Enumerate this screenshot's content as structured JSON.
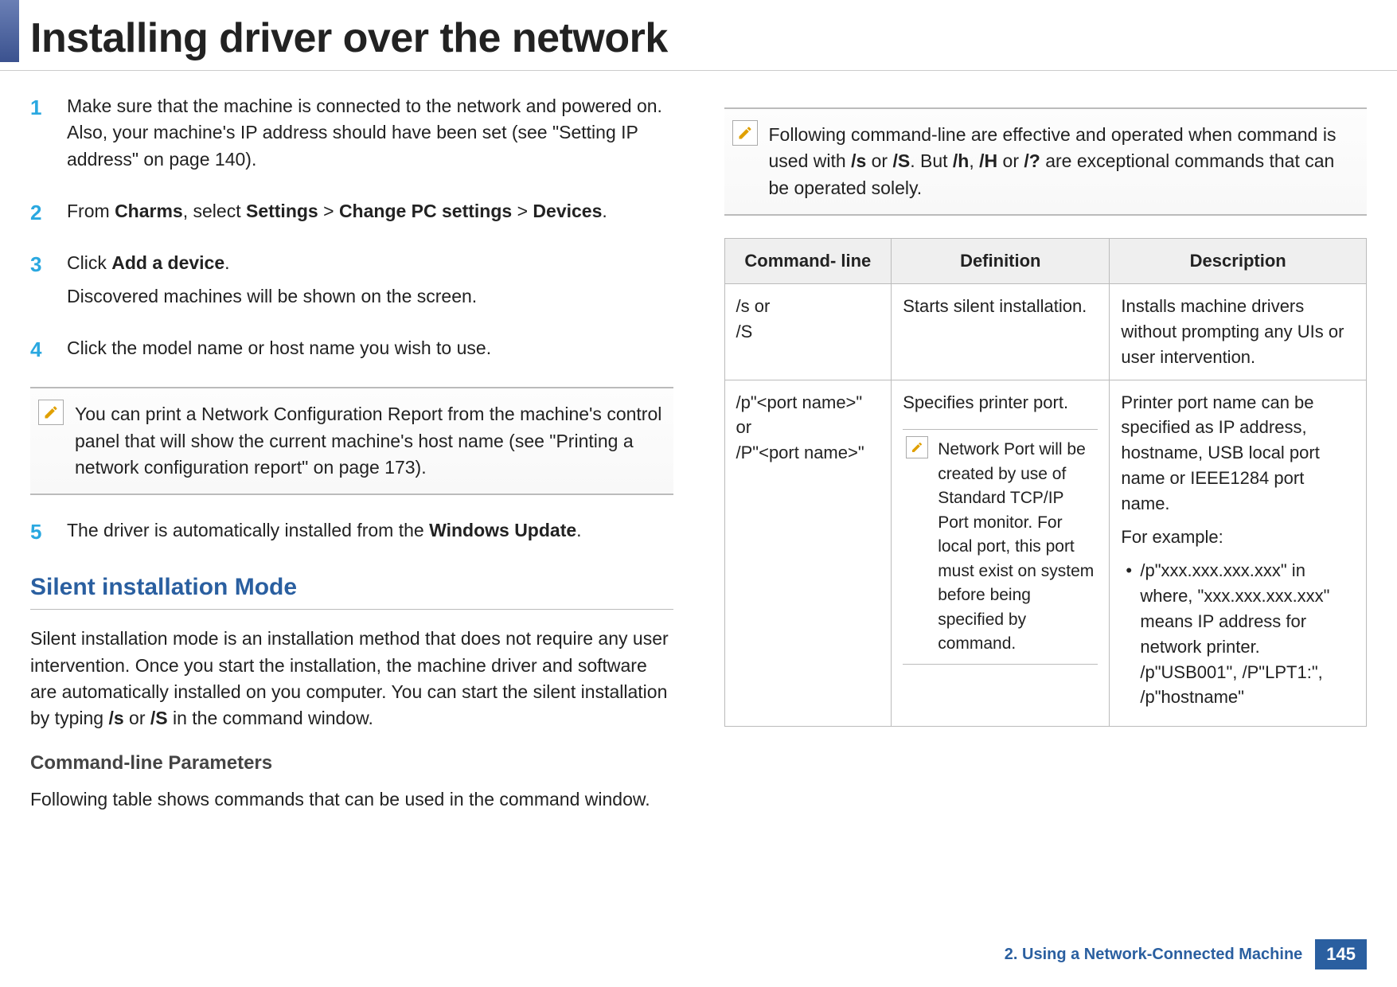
{
  "header": {
    "title": "Installing driver over the network"
  },
  "steps": [
    {
      "num": "1",
      "html": "Make sure that the machine is connected to the network and powered on. Also, your machine's IP address should have been set (see \"Setting IP address\" on page 140)."
    },
    {
      "num": "2",
      "html": "From <b>Charms</b>, select <b>Settings</b> > <b>Change PC settings</b> > <b>Devices</b>."
    },
    {
      "num": "3",
      "html": "Click <b>Add a device</b>.",
      "extra": "Discovered machines will be shown on the screen."
    },
    {
      "num": "4",
      "html": "Click the model name or host name you wish to use."
    }
  ],
  "note1": "You can print a Network Configuration Report from the machine's control panel that will show the current machine's host name (see \"Printing a network configuration report\" on page 173).",
  "step5": {
    "num": "5",
    "html": "The driver is automatically installed from the <b>Windows Update</b>."
  },
  "section": {
    "title": "Silent installation Mode",
    "intro": "Silent installation mode is an installation method that does not require any user intervention. Once you start the installation, the machine driver and software are automatically installed on you computer. You can start the silent installation by typing <b>/s</b> or <b>/S</b> in the command window.",
    "subsection": "Command-line Parameters",
    "subintro": "Following table shows commands that can be used in the command window."
  },
  "note2": "Following command-line are effective and operated when command is used with <b>/s</b> or <b>/S</b>. But <b>/h</b>, <b>/H</b> or <b>/?</b> are exceptional commands that can be operated solely.",
  "table": {
    "headers": [
      "Command- line",
      "Definition",
      "Description"
    ],
    "rows": [
      {
        "cmd_lines": [
          "/s or",
          "/S"
        ],
        "definition_text": "Starts silent installation.",
        "definition_note": null,
        "description_text": "Installs machine drivers without prompting any UIs or user intervention.",
        "description_example_label": null,
        "description_bullets": []
      },
      {
        "cmd_lines": [
          "/p\"<port name>\" or",
          "/P\"<port name>\""
        ],
        "definition_text": "Specifies printer port.",
        "definition_note": "Network Port will be created by use of Standard TCP/IP Port monitor. For local port, this port must exist on system before being specified by command.",
        "description_text": "Printer port name can be specified as IP address, hostname, USB local port name or IEEE1284 port name.",
        "description_example_label": "For example:",
        "description_bullets": [
          "/p\"xxx.xxx.xxx.xxx\" in where, \"xxx.xxx.xxx.xxx\" means IP address for network printer. /p\"USB001\", /P\"LPT1:\", /p\"hostname\""
        ]
      }
    ]
  },
  "footer": {
    "chapter": "2.  Using a Network-Connected Machine",
    "page": "145"
  },
  "chart_data": {
    "type": "table",
    "title": "Command-line Parameters",
    "columns": [
      "Command-line",
      "Definition",
      "Description"
    ],
    "rows": [
      [
        "/s or /S",
        "Starts silent installation.",
        "Installs machine drivers without prompting any UIs or user intervention."
      ],
      [
        "/p\"<port name>\" or /P\"<port name>\"",
        "Specifies printer port. (Network Port will be created by use of Standard TCP/IP Port monitor. For local port, this port must exist on system before being specified by command.)",
        "Printer port name can be specified as IP address, hostname, USB local port name or IEEE1284 port name. For example: /p\"xxx.xxx.xxx.xxx\" in where, \"xxx.xxx.xxx.xxx\" means IP address for network printer. /p\"USB001\", /P\"LPT1:\", /p\"hostname\""
      ]
    ]
  }
}
